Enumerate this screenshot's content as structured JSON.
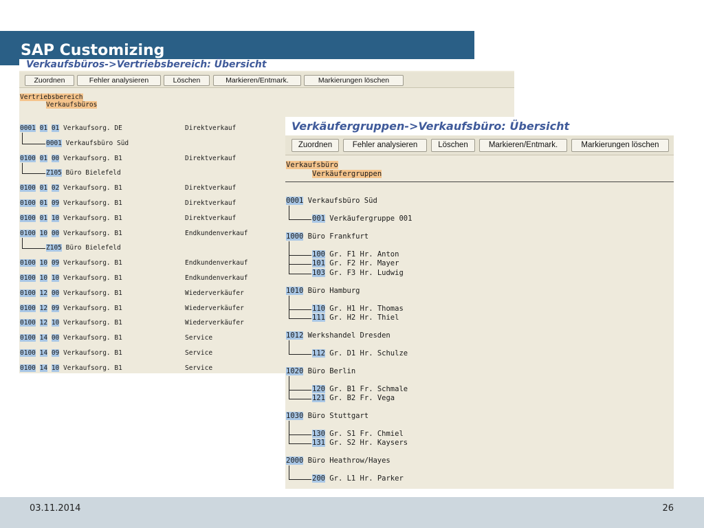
{
  "slide": {
    "title": "SAP Customizing",
    "footer_date": "03.11.2014",
    "page_number": "26"
  },
  "window1": {
    "title": "Verkaufsbüros->Vertriebsbereich: Übersicht",
    "toolbar": [
      "Zuordnen",
      "Fehler analysieren",
      "Löschen",
      "Markieren/Entmark.",
      "Markierungen löschen"
    ],
    "hierarchy": [
      "Vertriebsbereich",
      "Verkaufsbüros"
    ],
    "rows": [
      {
        "kind": "area",
        "codes": [
          "0001",
          "01",
          "01"
        ],
        "desc": "Verkaufsorg. DE",
        "type": "Direktverkauf"
      },
      {
        "kind": "office",
        "code": "0001",
        "desc": "Verkaufsbüro Süd"
      },
      {
        "kind": "area",
        "codes": [
          "0100",
          "01",
          "00"
        ],
        "desc": "Verkaufsorg. B1",
        "type": "Direktverkauf"
      },
      {
        "kind": "office",
        "code": "Z105",
        "desc": "Büro Bielefeld"
      },
      {
        "kind": "area",
        "codes": [
          "0100",
          "01",
          "02"
        ],
        "desc": "Verkaufsorg. B1",
        "type": "Direktverkauf"
      },
      {
        "kind": "area",
        "codes": [
          "0100",
          "01",
          "09"
        ],
        "desc": "Verkaufsorg. B1",
        "type": "Direktverkauf"
      },
      {
        "kind": "area",
        "codes": [
          "0100",
          "01",
          "10"
        ],
        "desc": "Verkaufsorg. B1",
        "type": "Direktverkauf"
      },
      {
        "kind": "area",
        "codes": [
          "0100",
          "10",
          "00"
        ],
        "desc": "Verkaufsorg. B1",
        "type": "Endkundenverkauf"
      },
      {
        "kind": "office",
        "code": "Z105",
        "desc": "Büro Bielefeld"
      },
      {
        "kind": "area",
        "codes": [
          "0100",
          "10",
          "09"
        ],
        "desc": "Verkaufsorg. B1",
        "type": "Endkundenverkauf"
      },
      {
        "kind": "area",
        "codes": [
          "0100",
          "10",
          "10"
        ],
        "desc": "Verkaufsorg. B1",
        "type": "Endkundenverkauf"
      },
      {
        "kind": "area",
        "codes": [
          "0100",
          "12",
          "00"
        ],
        "desc": "Verkaufsorg. B1",
        "type": "Wiederverkäufer"
      },
      {
        "kind": "area",
        "codes": [
          "0100",
          "12",
          "09"
        ],
        "desc": "Verkaufsorg. B1",
        "type": "Wiederverkäufer"
      },
      {
        "kind": "area",
        "codes": [
          "0100",
          "12",
          "10"
        ],
        "desc": "Verkaufsorg. B1",
        "type": "Wiederverkäufer"
      },
      {
        "kind": "area",
        "codes": [
          "0100",
          "14",
          "00"
        ],
        "desc": "Verkaufsorg. B1",
        "type": "Service"
      },
      {
        "kind": "area",
        "codes": [
          "0100",
          "14",
          "09"
        ],
        "desc": "Verkaufsorg. B1",
        "type": "Service"
      },
      {
        "kind": "area",
        "codes": [
          "0100",
          "14",
          "10"
        ],
        "desc": "Verkaufsorg. B1",
        "type": "Service"
      }
    ]
  },
  "window2": {
    "title": "Verkäufergruppen->Verkaufsbüro: Übersicht",
    "toolbar": [
      "Zuordnen",
      "Fehler analysieren",
      "Löschen",
      "Markieren/Entmark.",
      "Markierungen löschen"
    ],
    "hierarchy": [
      "Verkaufsbüro",
      "Verkäufergruppen"
    ],
    "offices": [
      {
        "code": "0001",
        "name": "Verkaufsbüro Süd",
        "groups": [
          {
            "code": "001",
            "desc": "Verkäufergruppe 001"
          }
        ]
      },
      {
        "code": "1000",
        "name": "Büro Frankfurt",
        "groups": [
          {
            "code": "100",
            "desc": "Gr. F1 Hr. Anton"
          },
          {
            "code": "101",
            "desc": "Gr. F2 Hr. Mayer"
          },
          {
            "code": "103",
            "desc": "Gr. F3 Hr. Ludwig"
          }
        ]
      },
      {
        "code": "1010",
        "name": "Büro Hamburg",
        "groups": [
          {
            "code": "110",
            "desc": "Gr. H1 Hr. Thomas"
          },
          {
            "code": "111",
            "desc": "Gr. H2 Hr. Thiel"
          }
        ]
      },
      {
        "code": "1012",
        "name": "Werkshandel Dresden",
        "groups": [
          {
            "code": "112",
            "desc": "Gr. D1 Hr. Schulze"
          }
        ]
      },
      {
        "code": "1020",
        "name": "Büro Berlin",
        "groups": [
          {
            "code": "120",
            "desc": "Gr. B1 Fr. Schmale"
          },
          {
            "code": "121",
            "desc": "Gr. B2 Fr. Vega"
          }
        ]
      },
      {
        "code": "1030",
        "name": "Büro Stuttgart",
        "groups": [
          {
            "code": "130",
            "desc": "Gr. S1 Fr. Chmiel"
          },
          {
            "code": "131",
            "desc": "Gr. S2 Hr. Kaysers"
          }
        ]
      },
      {
        "code": "2000",
        "name": "Büro Heathrow/Hayes",
        "groups": [
          {
            "code": "200",
            "desc": "Gr. L1 Hr. Parker"
          }
        ]
      }
    ]
  }
}
